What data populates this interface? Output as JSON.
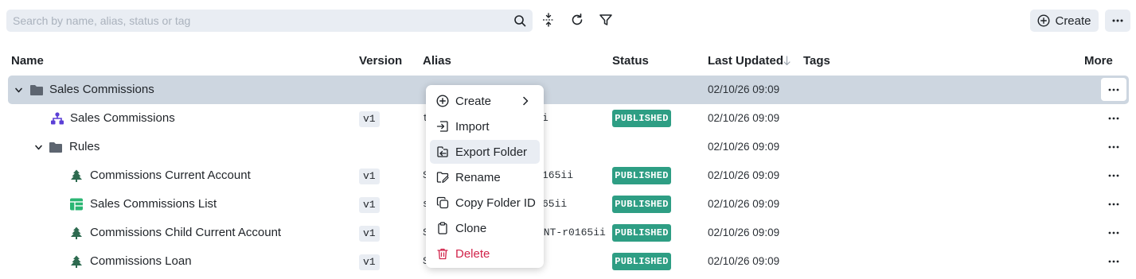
{
  "toolbar": {
    "search_placeholder": "Search by name, alias, status or tag",
    "create_label": "Create",
    "icons": [
      "search-icon",
      "collapse-expand-icon",
      "refresh-icon",
      "filter-icon",
      "plus-circle-icon",
      "more-icon"
    ]
  },
  "columns": {
    "name": "Name",
    "version": "Version",
    "alias": "Alias",
    "status": "Status",
    "last_updated": "Last Updated",
    "tags": "Tags",
    "more": "More"
  },
  "rows": [
    {
      "name": "Sales Commissions",
      "type": "folder",
      "expanded": true,
      "selected": true,
      "version": "",
      "alias": "",
      "status": "",
      "date": "02/10/26 09:09"
    },
    {
      "name": "Sales Commissions",
      "type": "decision-flow",
      "version": "v1",
      "alias": "t",
      "alias_tail": "i",
      "status": "PUBLISHED",
      "date": "02/10/26 09:09"
    },
    {
      "name": "Rules",
      "type": "folder",
      "expanded": true,
      "version": "",
      "alias": "",
      "status": "",
      "date": "02/10/26 09:09"
    },
    {
      "name": "Commissions Current Account",
      "type": "decision-tree",
      "version": "v1",
      "alias": "S",
      "alias_tail": "165ii",
      "status": "PUBLISHED",
      "date": "02/10/26 09:09"
    },
    {
      "name": "Sales Commissions List",
      "type": "decision-table",
      "version": "v1",
      "alias": "s",
      "alias_tail": "65ii",
      "status": "PUBLISHED",
      "date": "02/10/26 09:09"
    },
    {
      "name": "Commissions Child Current Account",
      "type": "decision-tree",
      "version": "v1",
      "alias": "S",
      "alias_tail": "UNT-r0165ii",
      "status": "PUBLISHED",
      "date": "02/10/26 09:09"
    },
    {
      "name": "Commissions Loan",
      "type": "decision-tree",
      "version": "v1",
      "alias": "S",
      "alias_tail": "",
      "status": "PUBLISHED",
      "date": "02/10/26 09:09"
    }
  ],
  "context_menu": {
    "items": [
      {
        "label": "Create",
        "icon": "plus-circle-icon",
        "submenu": true
      },
      {
        "label": "Import",
        "icon": "import-icon"
      },
      {
        "label": "Export Folder",
        "icon": "export-icon",
        "highlighted": true
      },
      {
        "label": "Rename",
        "icon": "rename-icon"
      },
      {
        "label": "Copy Folder ID",
        "icon": "copy-icon"
      },
      {
        "label": "Clone",
        "icon": "clipboard-icon"
      },
      {
        "label": "Delete",
        "icon": "trash-icon",
        "danger": true
      }
    ]
  },
  "colors": {
    "accent_bg": "#e9edf3",
    "selected_row": "#cdd6e0",
    "published": "#2e9e84",
    "danger": "#d1234a",
    "flow_icon": "#5b3fd6",
    "table_icon": "#2bb673",
    "tree_icon": "#2d6a4f",
    "folder_icon": "#5d6570"
  }
}
